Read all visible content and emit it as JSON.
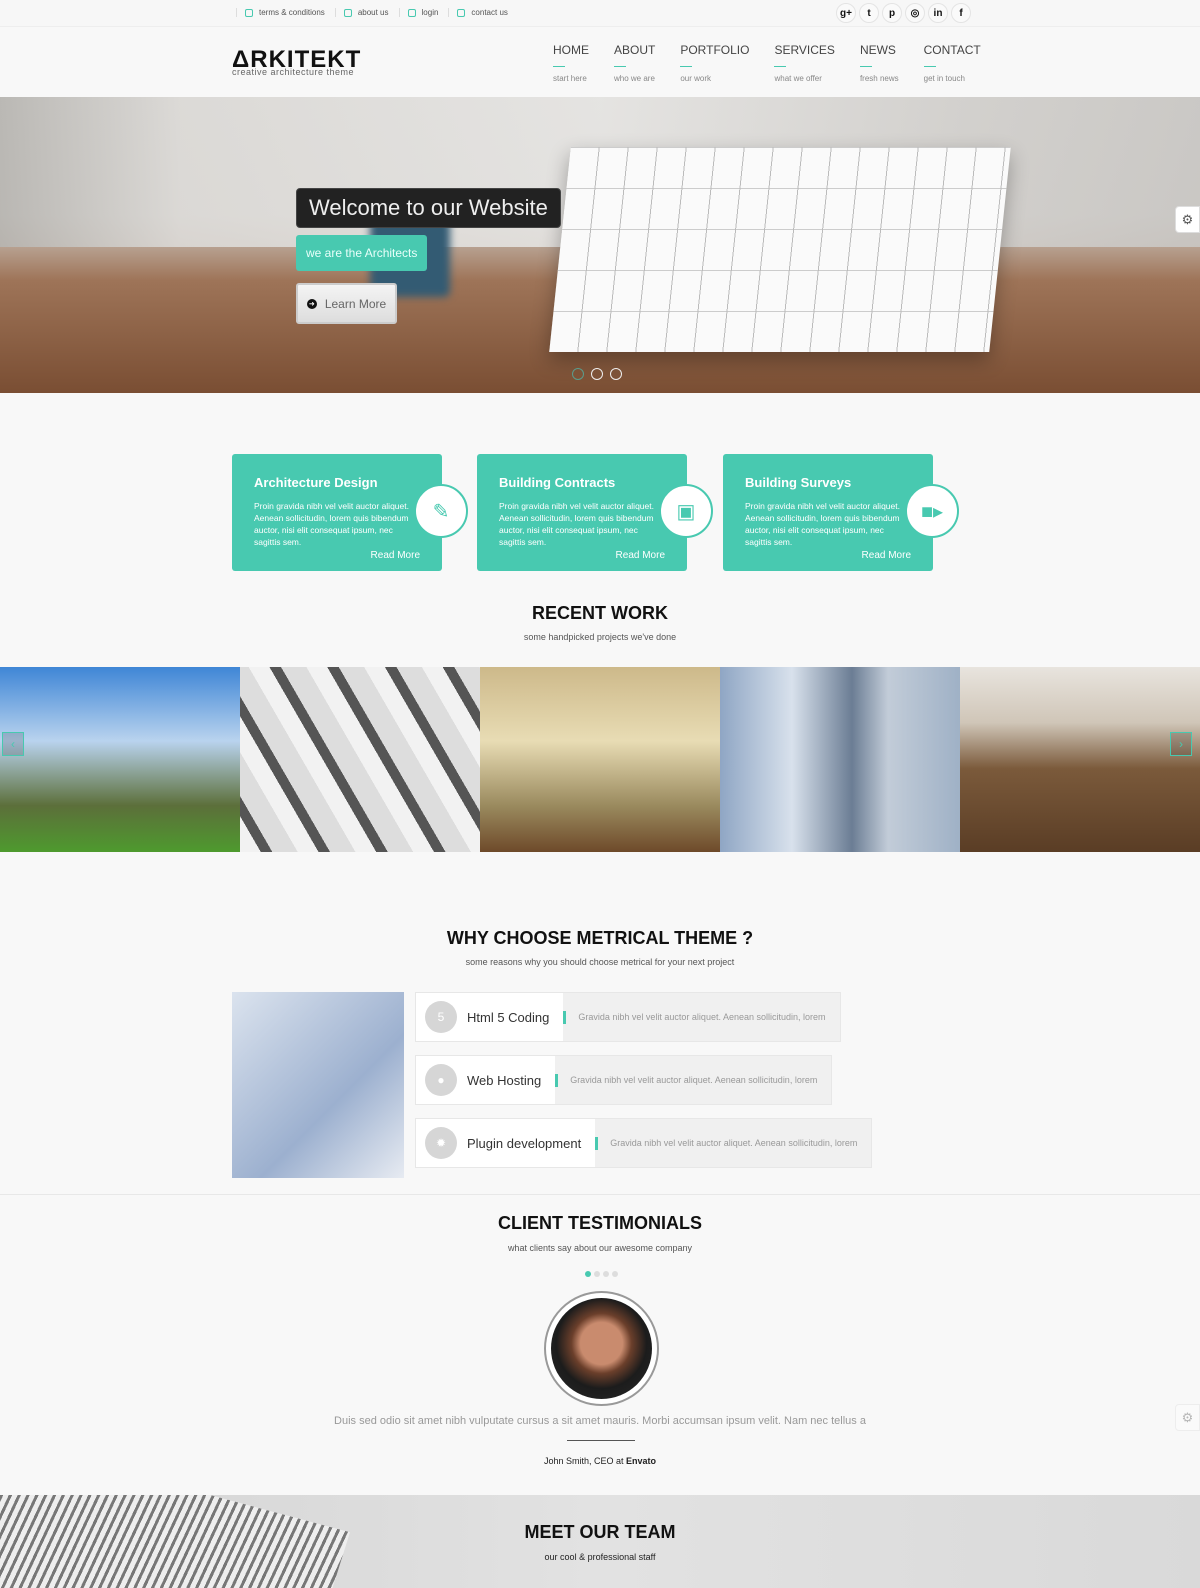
{
  "colors": {
    "accent": "#48c9b0",
    "dark": "#222222"
  },
  "topbar": {
    "links": [
      "terms & conditions",
      "about us",
      "login",
      "contact us"
    ],
    "social": [
      {
        "icon": "google-plus-icon",
        "glyph": "g+"
      },
      {
        "icon": "twitter-icon",
        "glyph": "t"
      },
      {
        "icon": "pinterest-icon",
        "glyph": "p"
      },
      {
        "icon": "dribbble-icon",
        "glyph": "◎"
      },
      {
        "icon": "linkedin-icon",
        "glyph": "in"
      },
      {
        "icon": "facebook-icon",
        "glyph": "f"
      }
    ]
  },
  "header": {
    "logo": "ΔRKITEKT",
    "tagline": "creative architecture theme",
    "nav": [
      {
        "label": "HOME",
        "sub": "start here"
      },
      {
        "label": "ABOUT",
        "sub": "who we are"
      },
      {
        "label": "PORTFOLIO",
        "sub": "our work"
      },
      {
        "label": "SERVICES",
        "sub": "what we offer"
      },
      {
        "label": "NEWS",
        "sub": "fresh news"
      },
      {
        "label": "CONTACT",
        "sub": "get in touch"
      }
    ]
  },
  "hero": {
    "title": "Welcome to our Website",
    "subtitle": "we are the Architects",
    "button": "Learn More",
    "slides": 3,
    "active_slide": 1
  },
  "services": [
    {
      "title": "Architecture Design",
      "text": "Proin gravida nibh vel velit auctor aliquet. Aenean sollicitudin, lorem quis bibendum auctor, nisi elit consequat ipsum, nec sagittis sem.",
      "link": "Read More",
      "icon": "edit-icon",
      "glyph": "✎"
    },
    {
      "title": "Building Contracts",
      "text": "Proin gravida nibh vel velit auctor aliquet. Aenean sollicitudin, lorem quis bibendum auctor, nisi elit consequat ipsum, nec sagittis sem.",
      "link": "Read More",
      "icon": "image-icon",
      "glyph": "▣"
    },
    {
      "title": "Building Surveys",
      "text": "Proin gravida nibh vel velit auctor aliquet. Aenean sollicitudin, lorem quis bibendum auctor, nisi elit consequat ipsum, nec sagittis sem.",
      "link": "Read More",
      "icon": "video-camera-icon",
      "glyph": "■▸"
    }
  ],
  "recent": {
    "title": "RECENT WORK",
    "subtitle": "some handpicked projects we've done"
  },
  "why": {
    "title": "WHY CHOOSE METRICAL THEME ?",
    "subtitle": "some reasons why you should choose metrical for your next project",
    "features": [
      {
        "label": "Html 5 Coding",
        "text": "Gravida nibh vel velit auctor aliquet. Aenean sollicitudin, lorem",
        "icon": "html5-icon",
        "glyph": "5"
      },
      {
        "label": "Web Hosting",
        "text": "Gravida nibh vel velit auctor aliquet. Aenean sollicitudin, lorem",
        "icon": "globe-icon",
        "glyph": "●"
      },
      {
        "label": "Plugin development",
        "text": "Gravida nibh vel velit auctor aliquet. Aenean sollicitudin, lorem",
        "icon": "gear-icon",
        "glyph": "✹"
      }
    ]
  },
  "testimonials": {
    "title": "CLIENT TESTIMONIALS",
    "subtitle": "what clients say about our awesome company",
    "quote": "Duis sed odio sit amet nibh vulputate cursus a sit amet mauris. Morbi accumsan ipsum velit. Nam nec tellus a",
    "author": "John Smith, CEO at ",
    "company": "Envato",
    "dots": 4,
    "active_dot": 1
  },
  "team": {
    "title": "MEET OUR TEAM",
    "subtitle": "our cool & professional staff"
  }
}
